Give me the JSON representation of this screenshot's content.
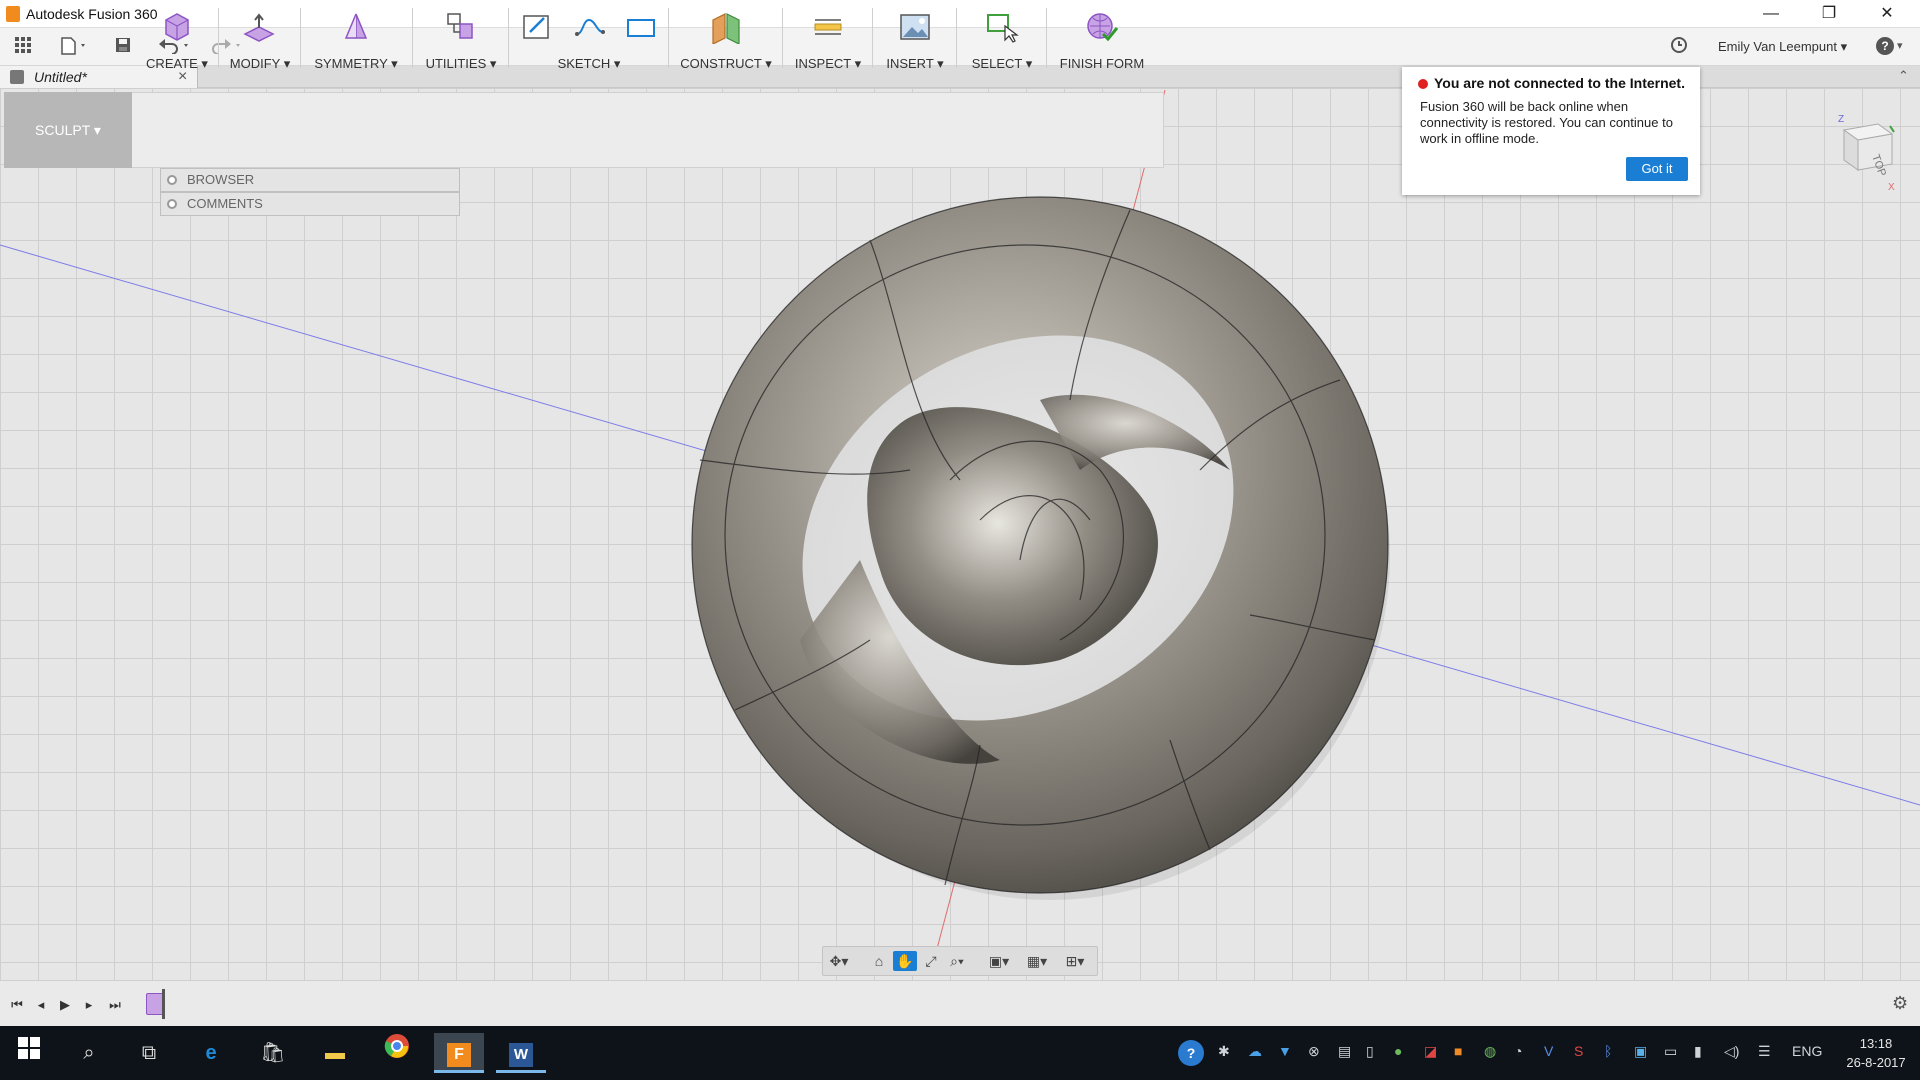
{
  "app": {
    "title": "Autodesk Fusion 360",
    "window_controls": {
      "minimize": "—",
      "restore": "❐",
      "close": "✕"
    }
  },
  "quick_access": {
    "user_name": "Emily Van Leempunt",
    "help_label": "?"
  },
  "document": {
    "tab_title": "Untitled*",
    "tab_close": "×"
  },
  "workspace": {
    "label": "SCULPT"
  },
  "toolbar": {
    "groups": [
      {
        "label": "CREATE"
      },
      {
        "label": "MODIFY"
      },
      {
        "label": "SYMMETRY"
      },
      {
        "label": "UTILITIES"
      },
      {
        "label": "SKETCH"
      },
      {
        "label": "CONSTRUCT"
      },
      {
        "label": "INSPECT"
      },
      {
        "label": "INSERT"
      },
      {
        "label": "SELECT"
      },
      {
        "label": "FINISH FORM"
      }
    ]
  },
  "panels": {
    "browser": "BROWSER",
    "comments": "COMMENTS"
  },
  "notification": {
    "heading": "You are not connected to the Internet.",
    "body": "Fusion 360 will be back online when connectivity is restored. You can continue to work in offline mode.",
    "button": "Got it"
  },
  "viewcube": {
    "face": "TOP",
    "axis_z": "Z",
    "axis_x": "X"
  },
  "taskbar": {
    "language": "ENG",
    "time": "13:18",
    "date": "26-8-2017"
  },
  "colors": {
    "accent": "#1a7fd4",
    "alert": "#e02020",
    "taskbar": "#0d1318",
    "model_metal": "#8f8b83"
  }
}
